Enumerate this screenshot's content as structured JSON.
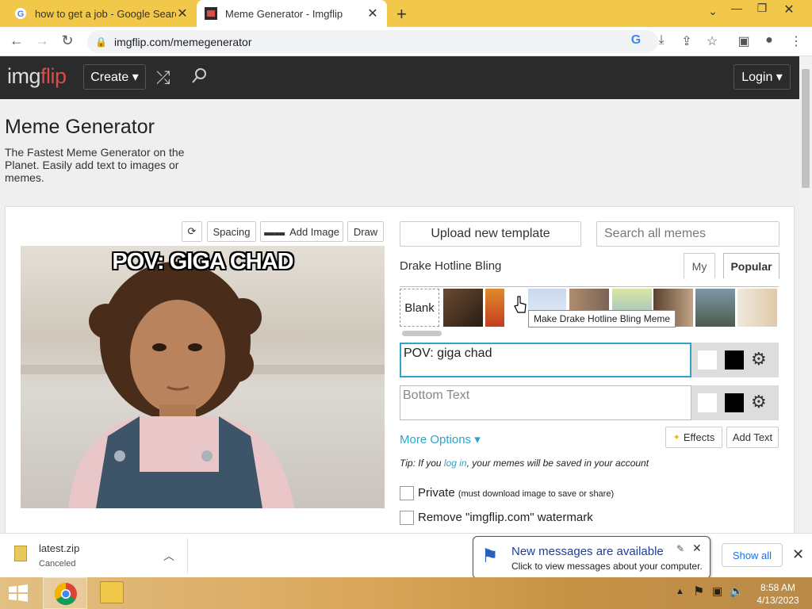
{
  "browser": {
    "tabs": [
      {
        "title": "how to get a job - Google Search"
      },
      {
        "title": "Meme Generator - Imgflip"
      }
    ],
    "url": "imgflip.com/memegenerator",
    "new_tab_label": "+"
  },
  "header": {
    "logo_part1": "img",
    "logo_part2": "flip",
    "create_label": "Create ▾",
    "login_label": "Login ▾"
  },
  "page": {
    "title": "Meme Generator",
    "subtitle": "The Fastest Meme Generator on the Planet. Easily add text to images or memes."
  },
  "editor": {
    "spacing_label": "Spacing",
    "add_image_label": "Add Image",
    "draw_label": "Draw",
    "meme_top_text": "POV: GIGA CHAD",
    "upload_label": "Upload new template",
    "search_placeholder": "Search all memes",
    "template_name": "Drake Hotline Bling",
    "tab_my": "My",
    "tab_popular": "Popular",
    "blank_label": "Blank",
    "tooltip": "Make Drake Hotline Bling Meme",
    "top_text_value": "POV: giga chad",
    "bottom_text_placeholder": "Bottom Text",
    "more_options": "More Options ▾",
    "effects_label": "Effects",
    "add_text_label": "Add Text",
    "tip_prefix": "Tip: If you ",
    "tip_link": "log in",
    "tip_suffix": ", your memes will be saved in your account",
    "private_label": "Private",
    "private_note": "(must download image to save or share)",
    "watermark_label": "Remove \"imgflip.com\" watermark"
  },
  "download": {
    "filename": "latest.zip",
    "status": "Canceled",
    "show_all": "Show all"
  },
  "notification": {
    "title": "New messages are available",
    "body": "Click to view messages about your computer."
  },
  "taskbar": {
    "time": "8:58 AM",
    "date": "4/13/2023"
  },
  "colors": {
    "tab_strip": "#f2c84b",
    "imgflip_header": "#2b2b2b",
    "accent_link": "#2fa4c6"
  }
}
